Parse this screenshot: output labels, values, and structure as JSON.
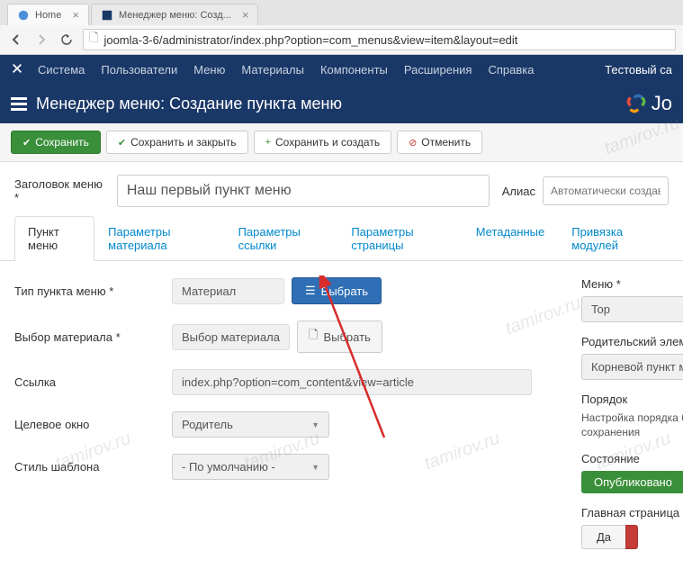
{
  "browser": {
    "tab1": "Home",
    "tab2": "Менеджер меню: Созд...",
    "url": "joomla-3-6/administrator/index.php?option=com_menus&view=item&layout=edit"
  },
  "topbar": {
    "items": [
      "Система",
      "Пользователи",
      "Меню",
      "Материалы",
      "Компоненты",
      "Расширения",
      "Справка"
    ],
    "test": "Тестовый са"
  },
  "header": {
    "title": "Менеджер меню: Создание пункта меню",
    "logo": "Jo"
  },
  "toolbar": {
    "save": "Сохранить",
    "save_close": "Сохранить и закрыть",
    "save_new": "Сохранить и создать",
    "cancel": "Отменить"
  },
  "form": {
    "title_label": "Заголовок меню *",
    "title_value": "Наш первый пункт меню",
    "alias_label": "Алиас",
    "alias_placeholder": "Автоматически создава"
  },
  "tabs": [
    "Пункт меню",
    "Параметры материала",
    "Параметры ссылки",
    "Параметры страницы",
    "Метаданные",
    "Привязка модулей"
  ],
  "fields": {
    "type_label": "Тип пункта меню *",
    "type_value": "Материал",
    "type_select": "Выбрать",
    "material_label": "Выбор материала *",
    "material_value": "Выбор материала",
    "material_select": "Выбрать",
    "link_label": "Ссылка",
    "link_value": "index.php?option=com_content&view=article",
    "target_label": "Целевое окно",
    "target_value": "Родитель",
    "style_label": "Стиль шаблона",
    "style_value": "- По умолчанию -"
  },
  "sidebar": {
    "menu_label": "Меню *",
    "menu_value": "Top",
    "parent_label": "Родительский элемент",
    "parent_value": "Корневой пункт меню",
    "order_label": "Порядок",
    "order_text": "Настройка порядка буд после сохранения",
    "state_label": "Состояние",
    "state_value": "Опубликовано",
    "main_label": "Главная страница",
    "main_yes": "Да"
  }
}
